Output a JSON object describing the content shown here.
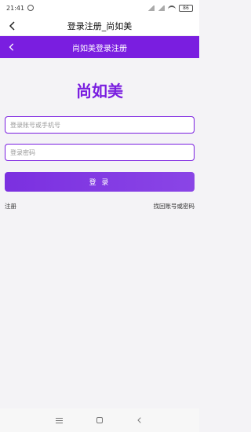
{
  "status_bar": {
    "time": "21:41",
    "battery": "86"
  },
  "app_header": {
    "title": "登录注册_尚如美"
  },
  "web_header": {
    "title": "尚如美登录注册"
  },
  "brand": {
    "name": "尚如美"
  },
  "form": {
    "account_placeholder": "登录账号或手机号",
    "password_placeholder": "登录密码",
    "login_label": "登 录"
  },
  "links": {
    "register": "注册",
    "recover": "找回账号或密码"
  },
  "colors": {
    "accent": "#7a1ee0",
    "background": "#f4f3f6"
  }
}
